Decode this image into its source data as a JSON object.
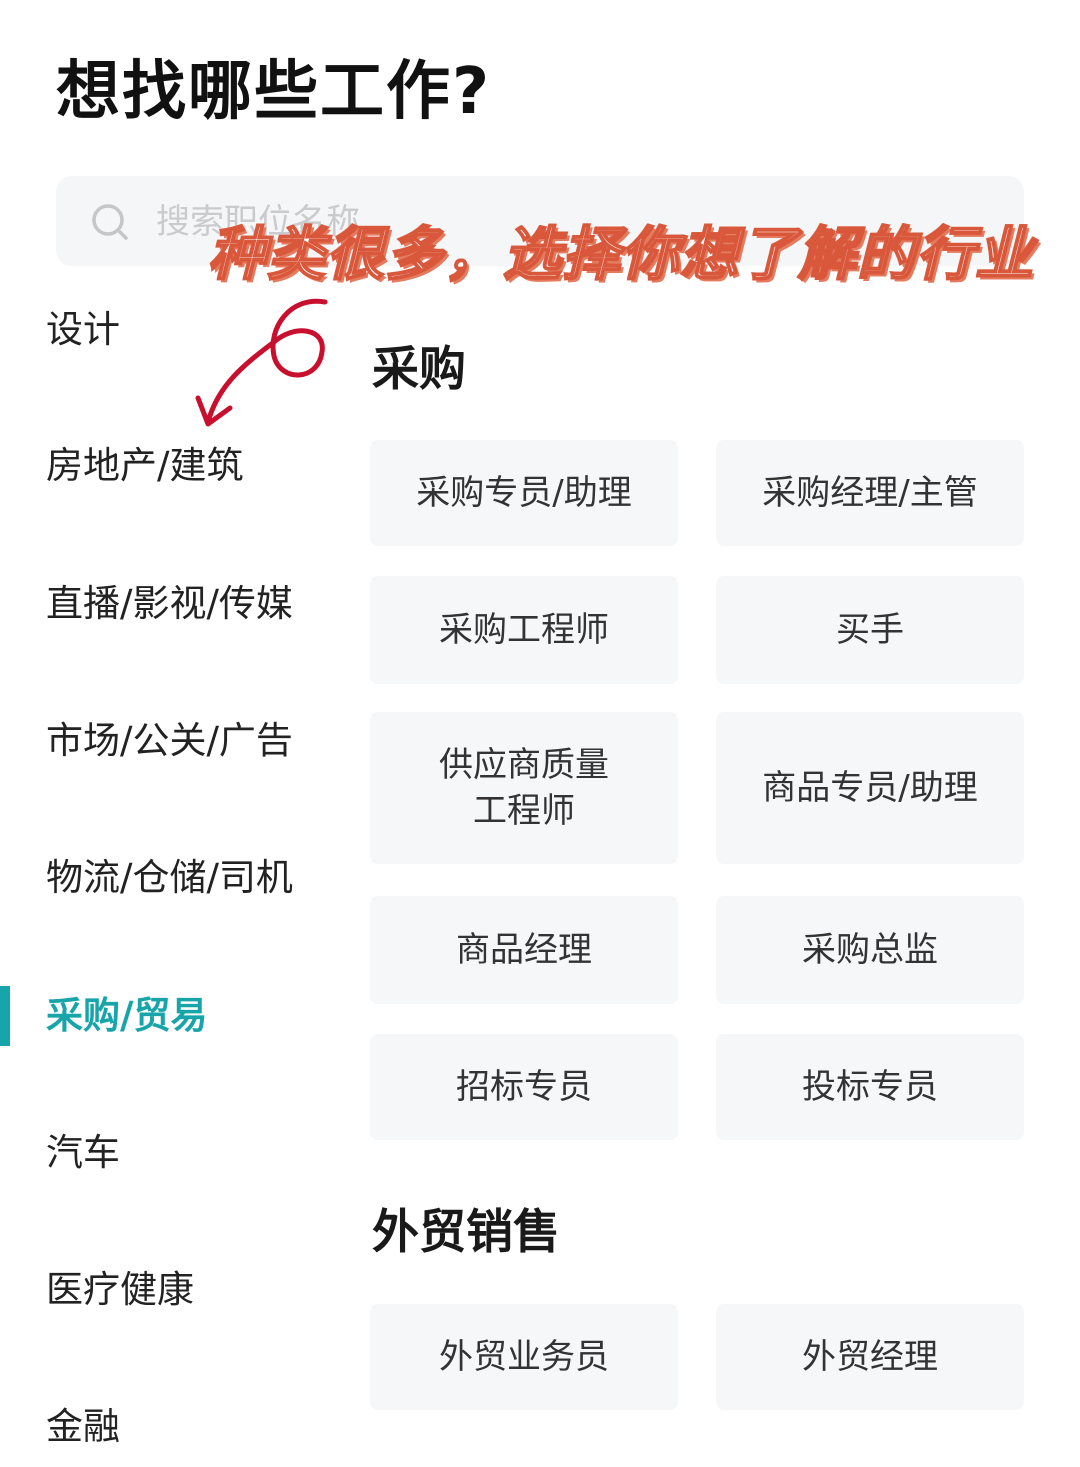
{
  "header": {
    "title": "想找哪些工作?"
  },
  "search": {
    "placeholder": "搜索职位名称"
  },
  "overlay": {
    "caption": "种类很多，选择你想了解的行业"
  },
  "sidebar": {
    "items": [
      {
        "label": "设计",
        "active": false
      },
      {
        "label": "房地产/建筑",
        "active": false
      },
      {
        "label": "直播/影视/传媒",
        "active": false
      },
      {
        "label": "市场/公关/广告",
        "active": false
      },
      {
        "label": "物流/仓储/司机",
        "active": false
      },
      {
        "label": "采购/贸易",
        "active": true
      },
      {
        "label": "汽车",
        "active": false
      },
      {
        "label": "医疗健康",
        "active": false
      },
      {
        "label": "金融",
        "active": false
      }
    ]
  },
  "sections": [
    {
      "title": "采购",
      "jobs": [
        "采购专员/助理",
        "采购经理/主管",
        "采购工程师",
        "买手",
        "供应商质量工程师",
        "商品专员/助理",
        "商品经理",
        "采购总监",
        "招标专员",
        "投标专员"
      ]
    },
    {
      "title": "外贸销售",
      "jobs": [
        "外贸业务员",
        "外贸经理"
      ]
    }
  ],
  "colors": {
    "accent": "#17a5a9",
    "chip_background": "#f6f7f8",
    "search_background": "#f5f6f7",
    "annotation_red": "#c8102e",
    "caption_outline": "#d9583b"
  },
  "icons": {
    "search": "search-icon",
    "annotation": "hand-drawn-arrow-icon"
  }
}
